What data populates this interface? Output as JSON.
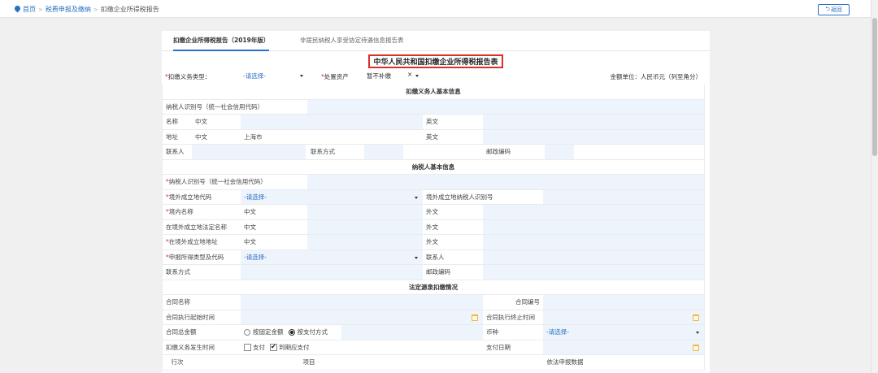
{
  "breadcrumb": {
    "home": "首页",
    "level1": "税费申报及缴纳",
    "current": "扣缴企业所得税报告"
  },
  "back_button": "返回",
  "tabs": [
    {
      "label": "扣缴企业所得税报告（2019年版）",
      "active": true
    },
    {
      "label": "非居民纳税人享受协定待遇信息报告表",
      "active": false
    }
  ],
  "form_title": "中华人民共和国扣缴企业所得税报告表",
  "options": {
    "withholding_type_label": "扣缴义务类型：",
    "withholding_type_value": "-请选择-",
    "disposal_label": "处置资产",
    "disposal_value": "暂不补缴",
    "disposal_clear": "×",
    "amount_unit": "金额单位：人民币元（列至角分）"
  },
  "sections": {
    "withholder": "扣缴义务人基本信息",
    "taxpayer": "纳税人基本信息",
    "source": "法定源泉扣缴情况"
  },
  "withholder": {
    "tax_id_label": "纳税人识别号（统一社会信用代码）",
    "name_label": "名称",
    "name_cn": "中文",
    "name_en": "英文",
    "addr_label": "地址",
    "addr_cn": "中文",
    "addr_cn_value": "上海市",
    "addr_en": "英文",
    "contact_label": "联系人",
    "contact_method_label": "联系方式",
    "postal_label": "邮政编码"
  },
  "taxpayer": {
    "tax_id_label": "纳税人识别号（统一社会信用代码）",
    "country_label": "境外成立地代码",
    "country_value": "-请选择-",
    "foreign_tax_id_label": "境外成立地纳税人识别号",
    "domestic_name_label": "境内名称",
    "domestic_name_cn": "中文",
    "domestic_name_foreign": "外文",
    "foreign_name_label": "在境外成立地法定名称",
    "foreign_name_cn": "中文",
    "foreign_name_foreign": "外文",
    "foreign_addr_label": "在境外成立地地址",
    "foreign_addr_cn": "中文",
    "foreign_addr_foreign": "外文",
    "income_type_label": "申报所得类型及代码",
    "income_type_value": "-请选择-",
    "contact_person_label": "联系人",
    "contact_method_label": "联系方式",
    "postal_label": "邮政编码"
  },
  "source": {
    "contract_name_label": "合同名称",
    "contract_no_label": "合同编号",
    "start_label": "合同执行起始时间",
    "end_label": "合同执行终止时间",
    "total_label": "合同总金额",
    "radio_fixed": "按固定金额",
    "radio_payment": "按支付方式",
    "currency_label": "币种",
    "currency_value": "-请选择-",
    "occur_label": "扣缴义务发生时间",
    "check_pay": "支付",
    "check_due": "到期应支付",
    "pay_date_label": "支付日期",
    "col_row": "行次",
    "col_item": "项目",
    "col_data": "依法申报数据"
  }
}
